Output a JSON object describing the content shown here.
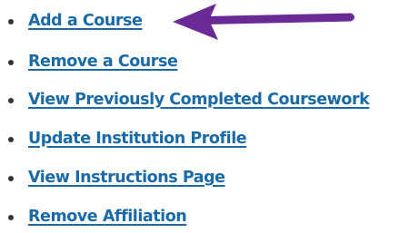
{
  "links": [
    {
      "label": "Add a Course"
    },
    {
      "label": "Remove a Course"
    },
    {
      "label": "View Previously Completed Coursework"
    },
    {
      "label": "Update Institution Profile"
    },
    {
      "label": "View Instructions Page"
    },
    {
      "label": "Remove Affiliation"
    }
  ],
  "colors": {
    "link": "#1a6aa8",
    "bullet": "#333333",
    "annotation_arrow": "#6a2a96"
  }
}
